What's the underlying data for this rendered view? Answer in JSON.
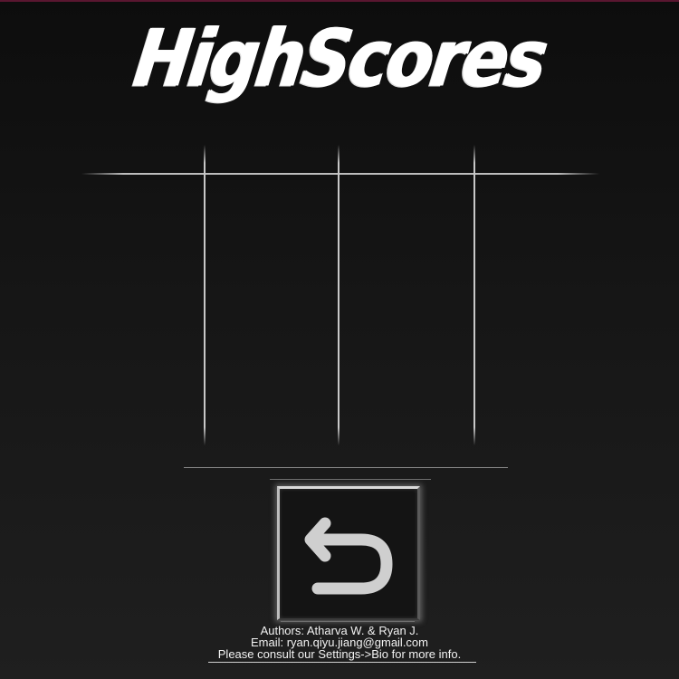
{
  "screen": {
    "title": "HighScores"
  },
  "table": {
    "columns": 4,
    "rows": []
  },
  "back_button": {
    "icon": "back-arrow-icon",
    "accent": "#cfcfcf"
  },
  "footer": {
    "authors": "Authors: Atharva W. & Ryan J.",
    "email": "Email: ryan.qiyu.jiang@gmail.com",
    "note": "Please consult our Settings->Bio for more info."
  },
  "colors": {
    "background_top": "#0d0d0d",
    "background_bottom": "#1f1f1f",
    "line": "#c8c8c8",
    "text": "#ffffff"
  }
}
